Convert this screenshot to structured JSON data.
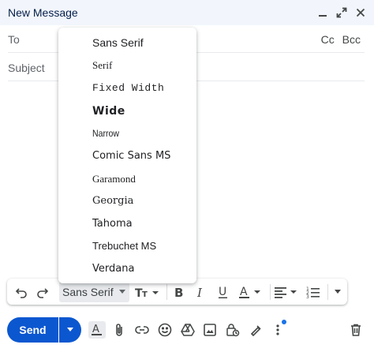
{
  "window": {
    "title": "New Message",
    "controls": [
      "minimize-icon",
      "expand-icon",
      "close-icon"
    ]
  },
  "recipients": {
    "to_label": "To",
    "cc_label": "Cc",
    "bcc_label": "Bcc"
  },
  "subject": {
    "placeholder": "Subject"
  },
  "font_menu": {
    "items": [
      "Sans Serif",
      "Serif",
      "Fixed Width",
      "Wide",
      "Narrow",
      "Comic Sans MS",
      "Garamond",
      "Georgia",
      "Tahoma",
      "Trebuchet MS",
      "Verdana"
    ]
  },
  "format_toolbar": {
    "font_selected": "Sans Serif",
    "icons": [
      "undo-icon",
      "redo-icon",
      "text-size-icon",
      "bold-icon",
      "italic-icon",
      "underline-icon",
      "text-color-icon",
      "align-icon",
      "numbered-list-icon",
      "more-formatting-icon"
    ]
  },
  "bottom_bar": {
    "send_label": "Send",
    "icons": [
      "formatting-options-icon",
      "attach-icon",
      "link-icon",
      "emoji-icon",
      "drive-icon",
      "photo-icon",
      "confidential-icon",
      "signature-icon",
      "more-options-icon",
      "trash-icon"
    ]
  },
  "colors": {
    "accent": "#0b57d0",
    "title_bar_bg": "#f2f6fc",
    "notification_dot": "#1a73e8"
  }
}
